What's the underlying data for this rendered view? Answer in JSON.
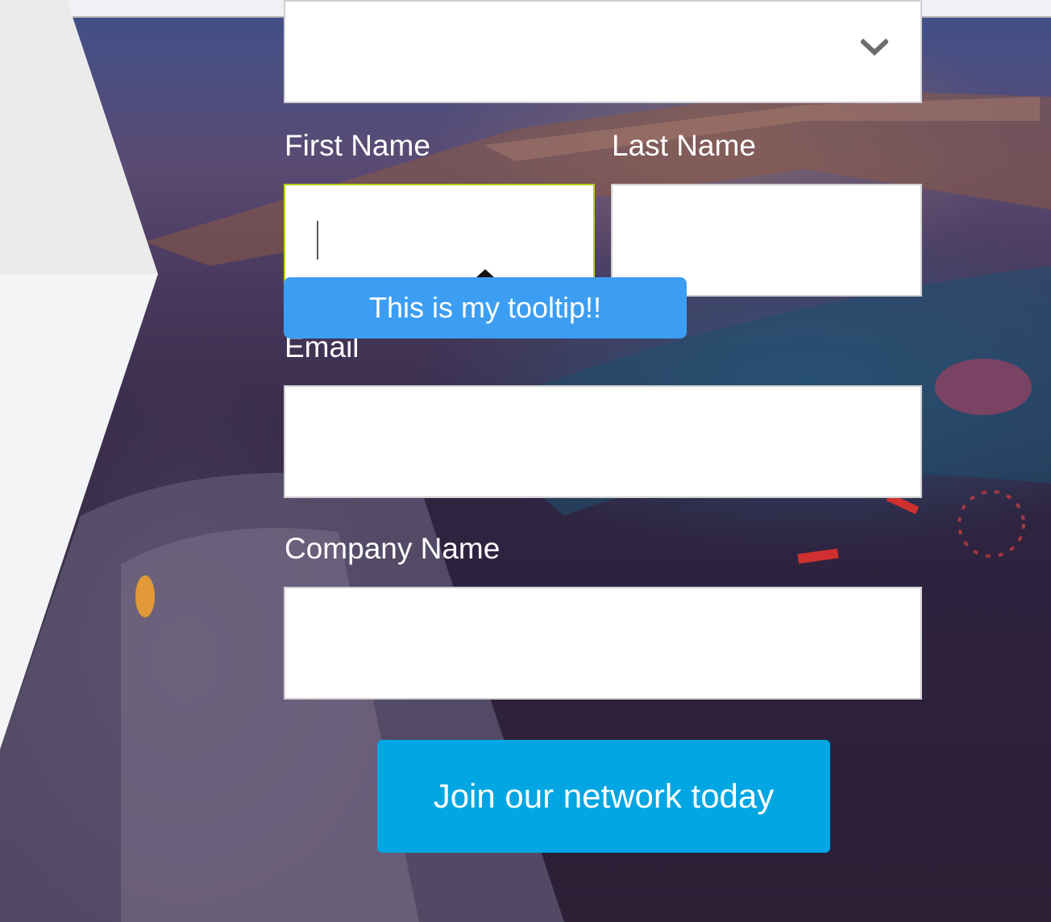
{
  "colors": {
    "button_bg": "#02a6e2",
    "tooltip_bg": "#3c9ef2",
    "focus_border": "#b7cf1a",
    "field_bg": "#ffffff",
    "label_text": "#ffffff"
  },
  "form": {
    "select": {
      "value": "",
      "icon": "chevron-down-icon"
    },
    "first_name": {
      "label": "First Name",
      "value": "",
      "focused": true
    },
    "last_name": {
      "label": "Last Name",
      "value": ""
    },
    "email": {
      "label": "Email",
      "value": ""
    },
    "company_name": {
      "label": "Company Name",
      "value": ""
    },
    "tooltip": {
      "text": "This is my tooltip!!"
    },
    "submit_label": "Join our network today"
  }
}
